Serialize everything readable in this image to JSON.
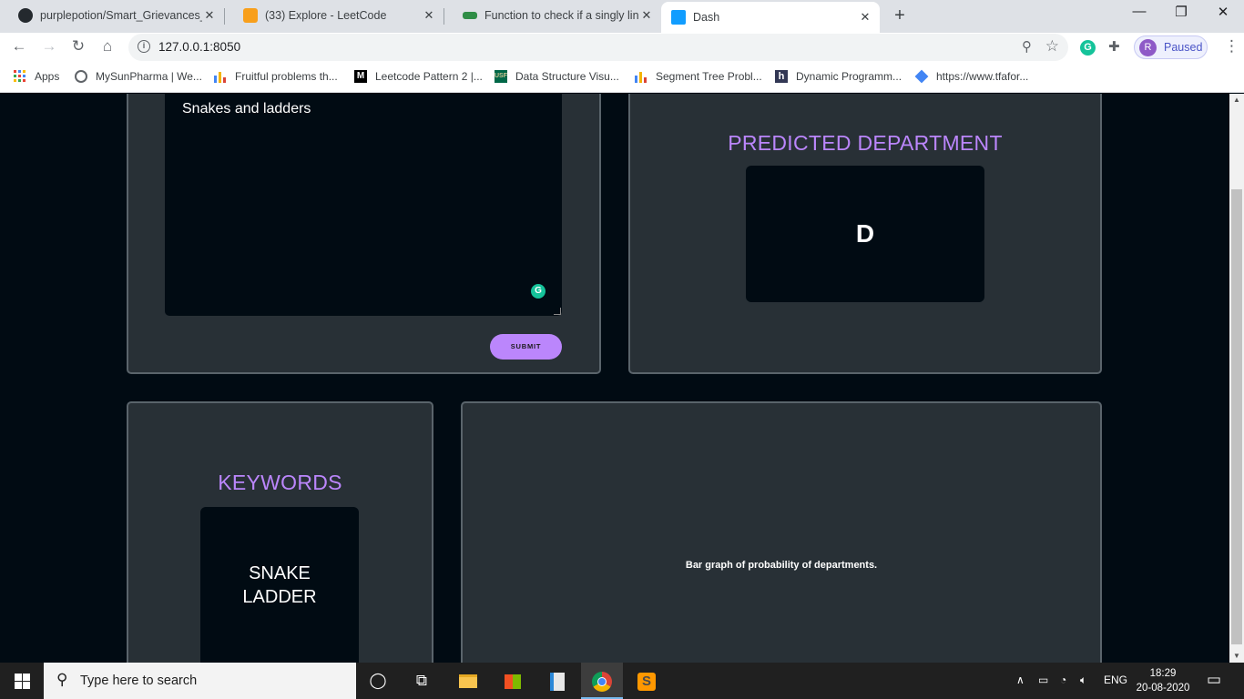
{
  "browser": {
    "tabs": [
      {
        "title": "purplepotion/Smart_Grievances_I",
        "close": "✕",
        "icon": "github-icon",
        "color": "#24292e"
      },
      {
        "title": "(33) Explore - LeetCode",
        "close": "✕",
        "icon": "leetcode-icon",
        "color": "#f89f1b"
      },
      {
        "title": "Function to check if a singly linke",
        "close": "✕",
        "icon": "geeksforgeeks-icon",
        "color": "#2f8d46"
      },
      {
        "title": "Dash",
        "close": "✕",
        "icon": "dash-icon",
        "color": "#119dff"
      }
    ],
    "new_tab": "+",
    "window": {
      "minimize": "—",
      "restore": "❐",
      "close": "✕"
    },
    "url": "127.0.0.1:8050",
    "profile": {
      "initial": "R",
      "label": "Paused"
    },
    "extension_initial": "G",
    "bookmarks": [
      {
        "label": "Apps",
        "icon": "apps-grid-icon",
        "color": "#ea4335"
      },
      {
        "label": "MySunPharma | We...",
        "icon": "globe-icon",
        "color": "#5f6368"
      },
      {
        "label": "Fruitful problems th...",
        "icon": "bar-chart-icon",
        "color": "#f4b400"
      },
      {
        "label": "Leetcode Pattern 2 |...",
        "icon": "medium-icon",
        "color": "#000000"
      },
      {
        "label": "Data Structure Visu...",
        "icon": "usf-icon",
        "color": "#006747"
      },
      {
        "label": "Segment Tree Probl...",
        "icon": "bar-chart-icon",
        "color": "#f4b400"
      },
      {
        "label": "Dynamic Programm...",
        "icon": "hackerearth-icon",
        "color": "#323754"
      },
      {
        "label": "https://www.tfafor...",
        "icon": "diamond-icon",
        "color": "#4285f4"
      }
    ]
  },
  "app": {
    "complaint_text": "Snakes and ladders",
    "grammarly_initial": "G",
    "submit_label": "SUBMIT",
    "department_heading": "PREDICTED DEPARTMENT",
    "department_value": "D",
    "keywords_heading": "KEYWORDS",
    "keywords": [
      "SNAKE",
      "LADDER"
    ],
    "graph_caption": "Bar graph of probability of departments.",
    "accent_color": "#bb86fc"
  },
  "taskbar": {
    "search_placeholder": "Type here to search",
    "language": "ENG",
    "time": "18:29",
    "date": "20-08-2020"
  }
}
